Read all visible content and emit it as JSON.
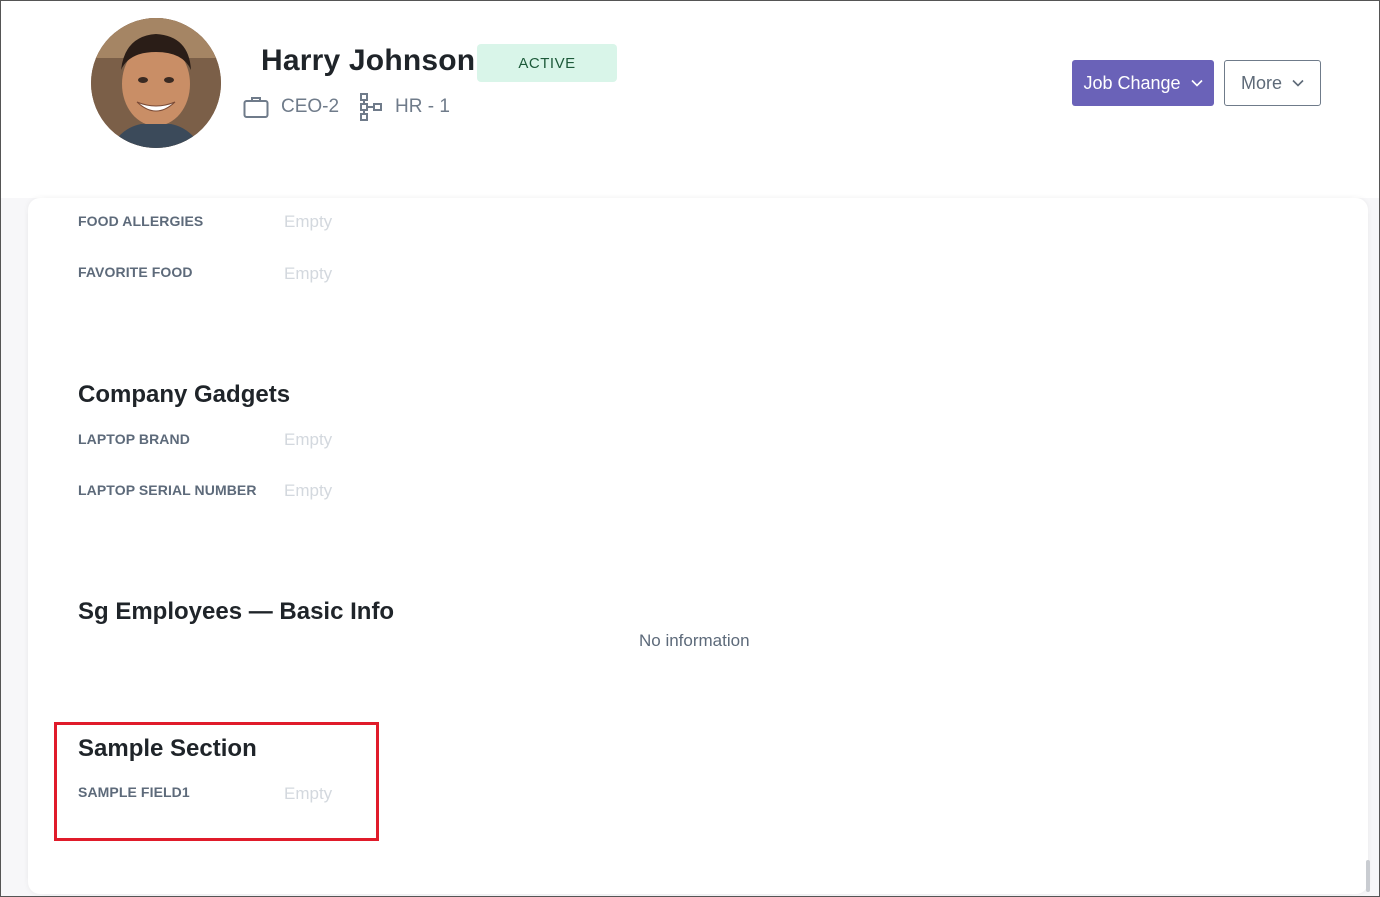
{
  "profile": {
    "name": "Harry Johnson",
    "status": "ACTIVE",
    "role": "CEO-2",
    "department": "HR - 1",
    "avatar_icon": "avatar-photo"
  },
  "actions": {
    "job_change_label": "Job Change",
    "more_label": "More"
  },
  "colors": {
    "primary": "#6a62b8",
    "status_bg": "#d9f5e9",
    "status_text": "#1d5a3a",
    "highlight": "#e01b2a"
  },
  "sections": {
    "food": {
      "fields": [
        {
          "label": "FOOD ALLERGIES",
          "value": "Empty"
        },
        {
          "label": "FAVORITE FOOD",
          "value": "Empty"
        }
      ]
    },
    "gadgets": {
      "title": "Company Gadgets",
      "fields": [
        {
          "label": "LAPTOP BRAND",
          "value": "Empty"
        },
        {
          "label": "LAPTOP SERIAL NUMBER",
          "value": "Empty"
        }
      ]
    },
    "sg_basic": {
      "title": "Sg Employees — Basic Info",
      "empty_text": "No information"
    },
    "sample": {
      "title": "Sample Section",
      "fields": [
        {
          "label": "SAMPLE FIELD1",
          "value": "Empty"
        }
      ]
    }
  }
}
